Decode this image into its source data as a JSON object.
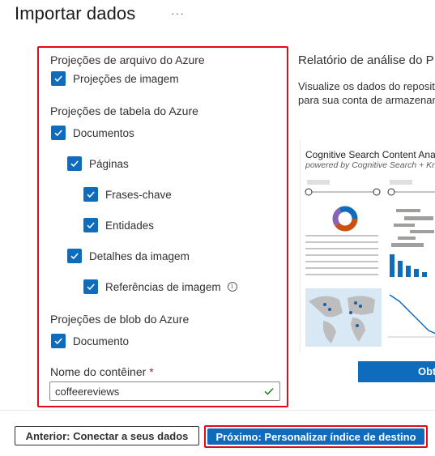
{
  "header": {
    "title": "Importar dados",
    "more_label": "···"
  },
  "projections": {
    "file_section": "Projeções de arquivo do Azure",
    "file_items": [
      "Projeções de imagem"
    ],
    "table_section": "Projeções de tabela do Azure",
    "table_items": {
      "documents": "Documentos",
      "pages": "Páginas",
      "key_phrases": "Frases-chave",
      "entities": "Entidades",
      "image_details": "Detalhes da imagem",
      "image_refs": "Referências de imagem"
    },
    "blob_section": "Projeções de blob do Azure",
    "blob_items": [
      "Documento"
    ],
    "container_label": "Nome do contêiner",
    "container_required": "*",
    "container_value": "coffeereviews"
  },
  "report": {
    "title": "Relatório de análise do P",
    "desc_line1": "Visualize os dados do reposito",
    "desc_line2": "para sua conta de armazenam",
    "preview_title": "Cognitive Search Content Analy",
    "preview_subtitle": "powered by Cognitive Search + Knowled",
    "open_label": "Obt"
  },
  "footer": {
    "prev_label": "Anterior: Conectar a seus dados",
    "next_label": "Próximo: Personalizar índice de destino"
  },
  "colors": {
    "accent": "#0f6cbd",
    "highlight": "#e00b1c"
  }
}
